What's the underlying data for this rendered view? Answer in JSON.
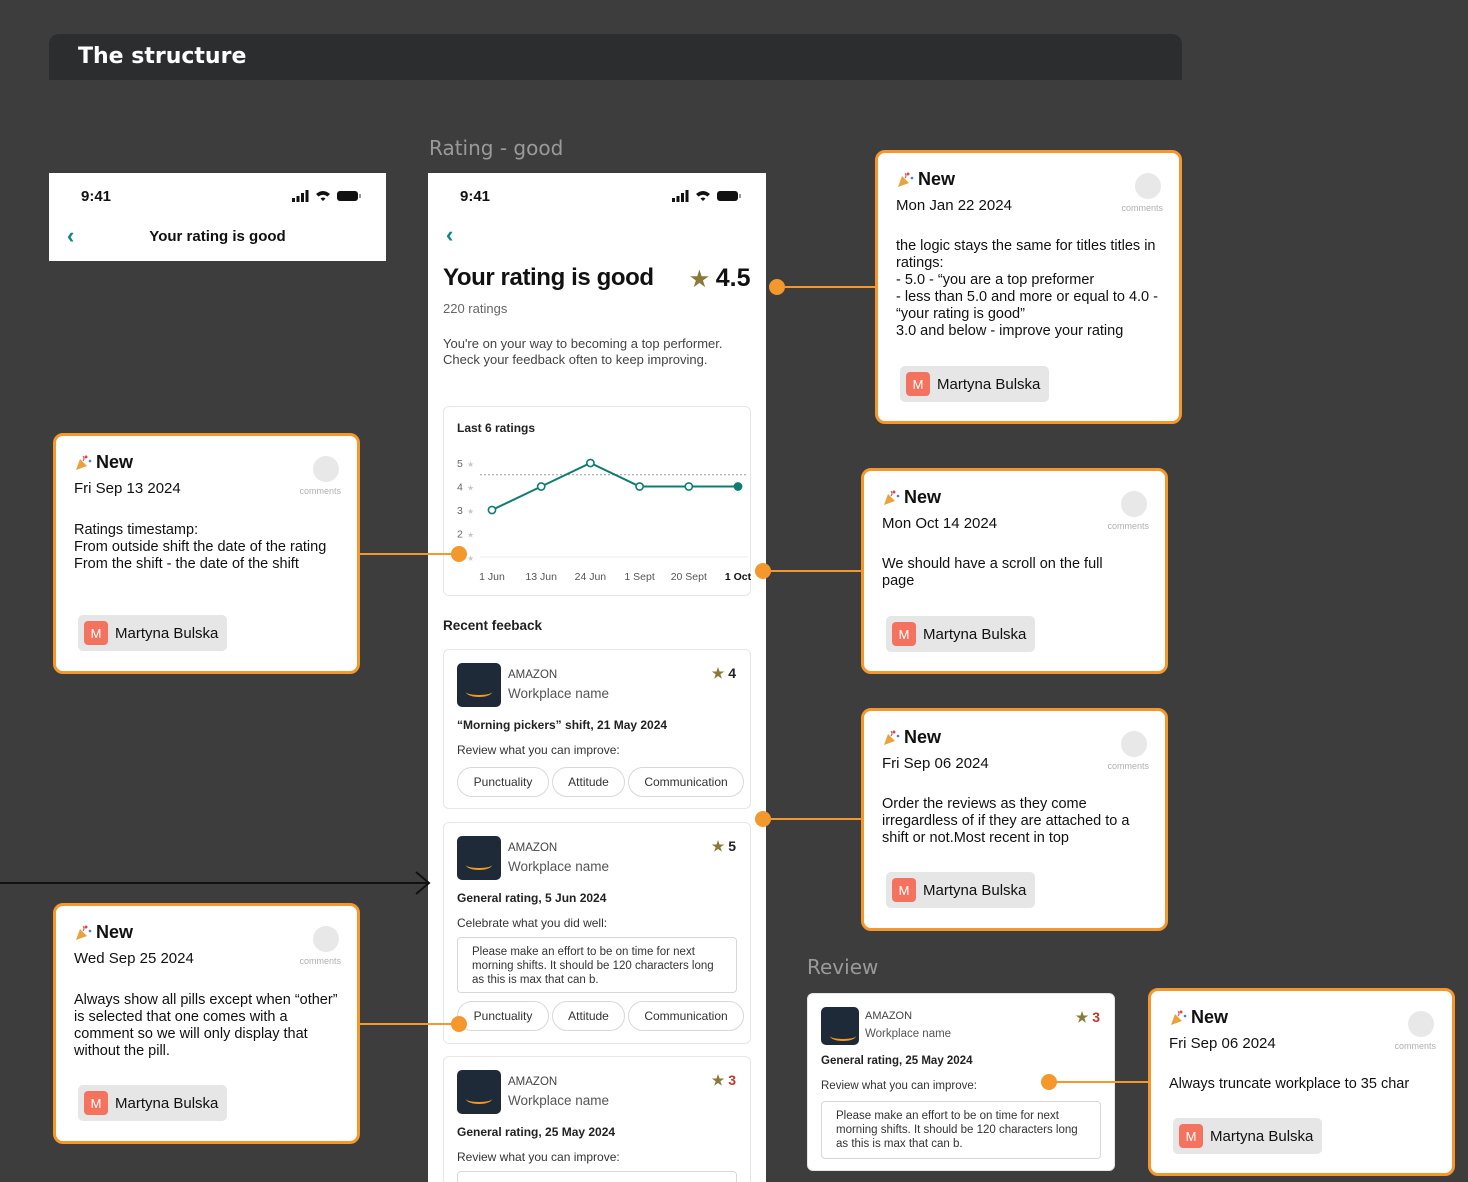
{
  "header": {
    "title": "The structure"
  },
  "frames": {
    "rating_good_label": "Rating - good",
    "review_label": "Review"
  },
  "small_phone": {
    "time": "9:41",
    "title": "Your rating is good"
  },
  "phone": {
    "time": "9:41",
    "title": "Your rating is good",
    "rating": "4.5",
    "ratings_count": "220 ratings",
    "description": "You're on your way to becoming a top performer. Check your feedback often to keep improving.",
    "recent_feedback_label": "Recent feeback"
  },
  "chart_data": {
    "type": "line",
    "title": "Last 6 ratings",
    "categories": [
      "1 Jun",
      "13 Jun",
      "24 Jun",
      "1 Sept",
      "20 Sept",
      "1 Oct"
    ],
    "values": [
      3,
      4,
      5,
      4,
      4,
      4
    ],
    "y_ticks": [
      "5",
      "4",
      "3",
      "2",
      ""
    ],
    "ylim": [
      1,
      5
    ],
    "reference_line": 4.5,
    "color": "#0e7d70",
    "grid": true
  },
  "feedback": [
    {
      "company": "AMAZON",
      "workplace": "Workplace name",
      "rating": "4",
      "shift": "“Morning pickers” shift, 21 May 2024",
      "prompt": "Review what you can improve:",
      "comment": "",
      "pills": [
        "Punctuality",
        "Attitude",
        "Communication"
      ]
    },
    {
      "company": "AMAZON",
      "workplace": "Workplace name",
      "rating": "5",
      "shift": "General rating, 5 Jun 2024",
      "prompt": "Celebrate what you did well:",
      "comment": "Please make an effort to be on time for next morning shifts. It should be 120 characters long as this is max that can b.",
      "pills": [
        "Punctuality",
        "Attitude",
        "Communication"
      ]
    },
    {
      "company": "AMAZON",
      "workplace": "Workplace name",
      "rating": "3",
      "shift": "General rating, 25 May 2024",
      "prompt": "Review what you can improve:",
      "comment": "",
      "pills": []
    }
  ],
  "review_card": {
    "company": "AMAZON",
    "workplace": "Workplace name",
    "rating": "3",
    "shift": "General rating, 25 May 2024",
    "prompt": "Review what you can improve:",
    "comment": "Please make an effort to be on time for next morning shifts. It should be 120 characters long as this is max that can b."
  },
  "comments": [
    {
      "badge": "New",
      "date": "Mon Jan 22 2024",
      "comments_label": "comments",
      "body": "the logic stays the same for titles titles in ratings:\n- 5.0 - “you are a top preformer\n- less than 5.0 and more or equal to 4.0 - “your rating is good”\n3.0 and below - improve your rating",
      "author_initial": "M",
      "author": "Martyna Bulska"
    },
    {
      "badge": "New",
      "date": "Fri Sep 13 2024",
      "comments_label": "comments",
      "body": "Ratings timestamp:\nFrom outside shift the date of the rating\nFrom the shift - the date of the shift",
      "author_initial": "M",
      "author": "Martyna Bulska"
    },
    {
      "badge": "New",
      "date": "Mon Oct 14 2024",
      "comments_label": "comments",
      "body": "We should have a scroll on the full page",
      "author_initial": "M",
      "author": "Martyna Bulska"
    },
    {
      "badge": "New",
      "date": "Fri Sep 06 2024",
      "comments_label": "comments",
      "body": "Order the reviews as they come irregardless of if they are attached to a shift or not.Most recent in top",
      "author_initial": "M",
      "author": "Martyna Bulska"
    },
    {
      "badge": "New",
      "date": "Wed Sep 25 2024",
      "comments_label": "comments",
      "body": "Always show all pills except when “other” is selected that one comes with a comment so we will only display that without the pill.",
      "author_initial": "M",
      "author": "Martyna Bulska"
    },
    {
      "badge": "New",
      "date": "Fri Sep 06 2024",
      "comments_label": "comments",
      "body": "Always truncate workplace to 35 char",
      "author_initial": "M",
      "author": "Martyna Bulska"
    }
  ]
}
